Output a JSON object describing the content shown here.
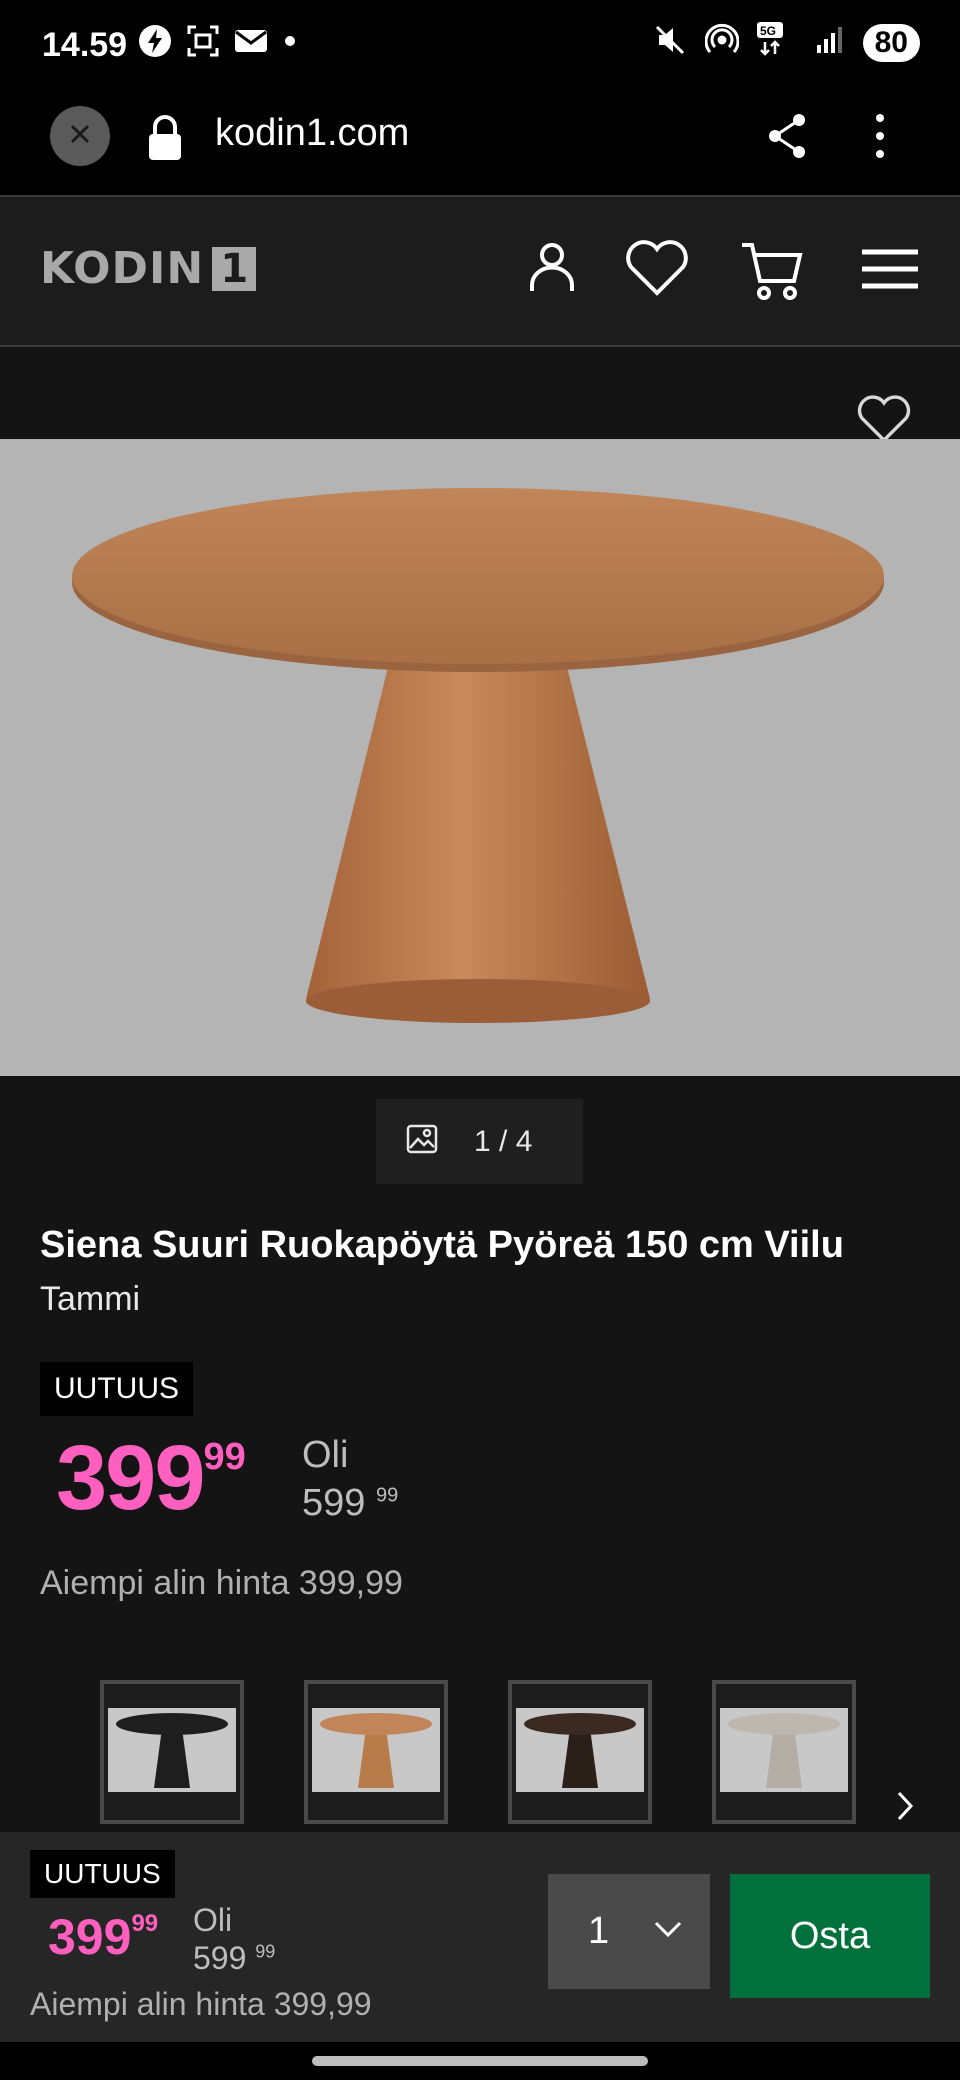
{
  "status_bar": {
    "time": "14.59",
    "battery": "80",
    "network": "5G"
  },
  "browser": {
    "url": "kodin1.com"
  },
  "site": {
    "logo_text": "KODIN",
    "logo_number": "1"
  },
  "gallery": {
    "counter": "1 / 4"
  },
  "product": {
    "title": "Siena Suuri Ruokapöytä Pyöreä 150 cm Viilu",
    "subtitle": "Tammi",
    "badge": "UUTUUS",
    "price_int": "399",
    "price_dec": "99",
    "old_label": "Oli",
    "old_price_int": "599",
    "old_price_dec": "99",
    "lowest_price": "Aiempi alin hinta 399,99"
  },
  "variants": [
    {
      "name": "musta",
      "color": "#1e1e1e"
    },
    {
      "name": "tammi",
      "color": "#b87c4a"
    },
    {
      "name": "tumma",
      "color": "#3a2a22"
    },
    {
      "name": "harmaa",
      "color": "#bdb7b0"
    }
  ],
  "bottom_bar": {
    "badge": "UUTUUS",
    "price_int": "399",
    "price_dec": "99",
    "old_label": "Oli",
    "old_price_int": "599",
    "old_price_dec": "99",
    "lowest_price": "Aiempi alin hinta 399,99",
    "quantity": "1",
    "buy_label": "Osta"
  },
  "colors": {
    "price_accent": "#ff5fbf",
    "buy_button": "#00703c"
  }
}
